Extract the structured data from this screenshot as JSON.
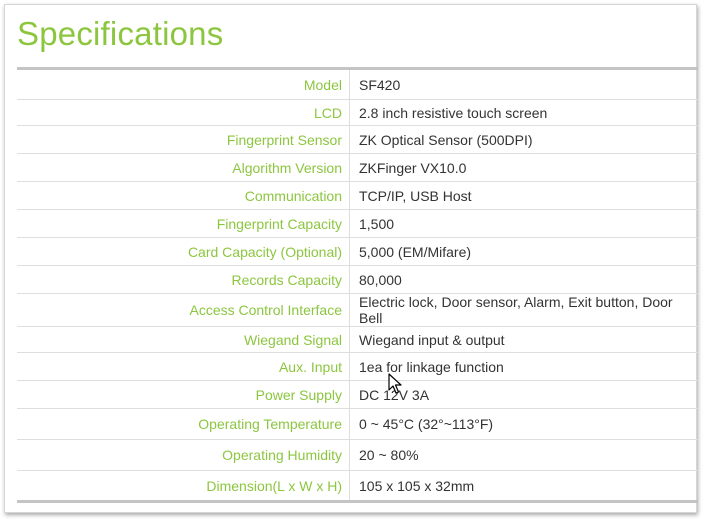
{
  "title": "Specifications",
  "specs": [
    {
      "label": "Model",
      "value": "SF420"
    },
    {
      "label": "LCD",
      "value": "2.8 inch resistive touch screen"
    },
    {
      "label": "Fingerprint Sensor",
      "value": "ZK Optical Sensor (500DPI)"
    },
    {
      "label": "Algorithm Version",
      "value": "ZKFinger VX10.0"
    },
    {
      "label": "Communication",
      "value": "TCP/IP, USB Host"
    },
    {
      "label": "Fingerprint Capacity",
      "value": "1,500"
    },
    {
      "label": "Card Capacity (Optional)",
      "value": "5,000 (EM/Mifare)"
    },
    {
      "label": "Records Capacity",
      "value": "80,000"
    },
    {
      "label": "Access Control Interface",
      "value": "Electric lock, Door sensor, Alarm, Exit button, Door Bell"
    },
    {
      "label": "Wiegand Signal",
      "value": "Wiegand input & output"
    },
    {
      "label": "Aux. Input",
      "value": "1ea for linkage function"
    },
    {
      "label": "Power Supply",
      "value": "DC 12V 3A"
    },
    {
      "label": "Operating Temperature",
      "value": "0 ~ 45°C (32°~113°F)"
    },
    {
      "label": "Operating Humidity",
      "value": "20 ~ 80%"
    },
    {
      "label": "Dimension(L x W x H)",
      "value": "105 x 105 x 32mm"
    }
  ],
  "colors": {
    "label": "#8cc63f",
    "value": "#333333",
    "rule": "#c4c4c4"
  },
  "icons": {
    "cursor": "mouse-pointer-icon"
  }
}
